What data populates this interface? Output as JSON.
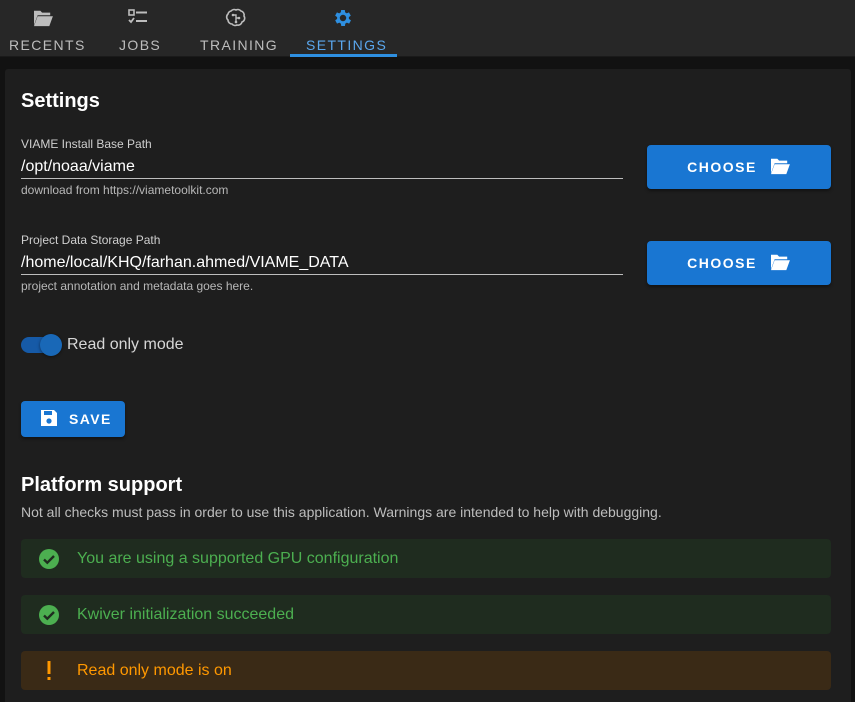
{
  "tabs": [
    {
      "label": "RECENTS",
      "icon": "folder-open-icon"
    },
    {
      "label": "JOBS",
      "icon": "checklist-icon"
    },
    {
      "label": "TRAINING",
      "icon": "brain-icon"
    },
    {
      "label": "SETTINGS",
      "icon": "gear-icon",
      "active": true
    }
  ],
  "settings": {
    "title": "Settings",
    "viame_path": {
      "label": "VIAME Install Base Path",
      "value": "/opt/noaa/viame",
      "hint": "download from https://viametoolkit.com",
      "button": "CHOOSE"
    },
    "data_path": {
      "label": "Project Data Storage Path",
      "value": "/home/local/KHQ/farhan.ahmed/VIAME_DATA",
      "hint": "project annotation and metadata goes here.",
      "button": "CHOOSE"
    },
    "read_only": {
      "label": "Read only mode",
      "on": true
    },
    "save_label": "SAVE"
  },
  "platform": {
    "title": "Platform support",
    "description": "Not all checks must pass in order to use this application. Warnings are intended to help with debugging.",
    "checks": [
      {
        "text": "You are using a supported GPU configuration",
        "status": "success"
      },
      {
        "text": "Kwiver initialization succeeded",
        "status": "success"
      },
      {
        "text": "Read only mode is on",
        "status": "warning"
      }
    ]
  },
  "colors": {
    "accent": "#1976d2",
    "active_tab": "#5aa7ee",
    "success": "#4caf50",
    "warning": "#ff9800"
  }
}
